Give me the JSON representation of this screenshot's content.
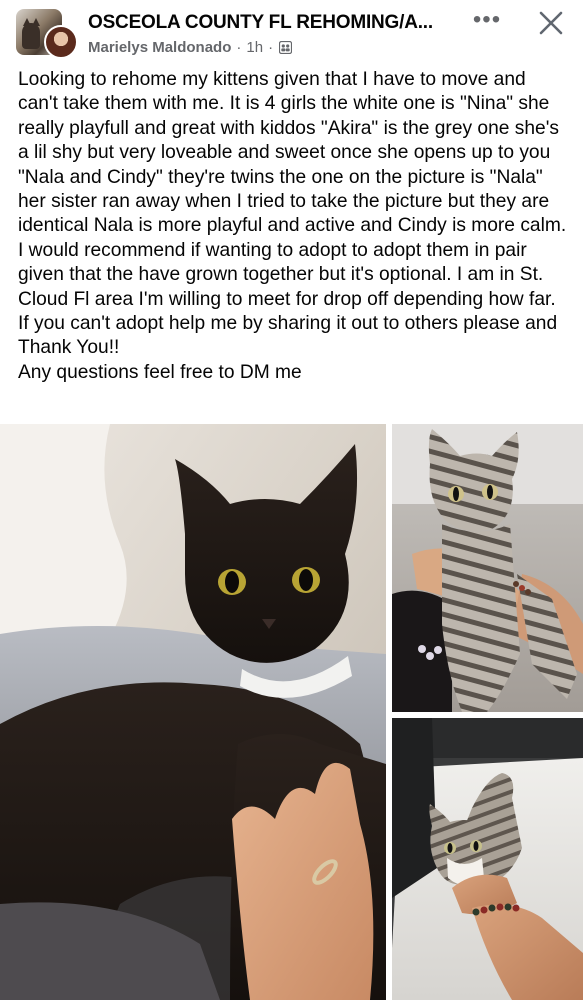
{
  "header": {
    "group_name": "OSCEOLA COUNTY FL REHOMING/A...",
    "author": "Marielys Maldonado",
    "time": "1h",
    "separator": "·",
    "more_label": "•••",
    "icons": {
      "group": "group-icon",
      "more": "more-options-icon",
      "close": "close-icon"
    }
  },
  "post": {
    "text": "Looking to rehome my kittens given that I have to move and can't take them with me. It is 4 girls the white one is \"Nina\" she really playfull and great with kiddos \"Akira\" is the grey one she's a lil shy but very loveable and sweet once she opens up to you \"Nala and Cindy\" they're twins the one on the picture is \"Nala\" her sister ran away when I tried to take the picture but they are identical Nala is more playful and active and Cindy is more calm. I would recommend if wanting to adopt to adopt them in pair given that the have grown together but it's optional. I am in St. Cloud Fl area I'm willing to meet for drop off depending how far. If you can't adopt help me by sharing it out to others please and Thank You!!\nAny questions feel free to DM me"
  },
  "photos": [
    {
      "subject": "black-kitten-with-hand"
    },
    {
      "subject": "grey-tabby-kitten-held"
    },
    {
      "subject": "tabby-white-kitten-on-table"
    }
  ],
  "colors": {
    "text": "#050505",
    "secondary": "#65676b",
    "background": "#ffffff"
  }
}
